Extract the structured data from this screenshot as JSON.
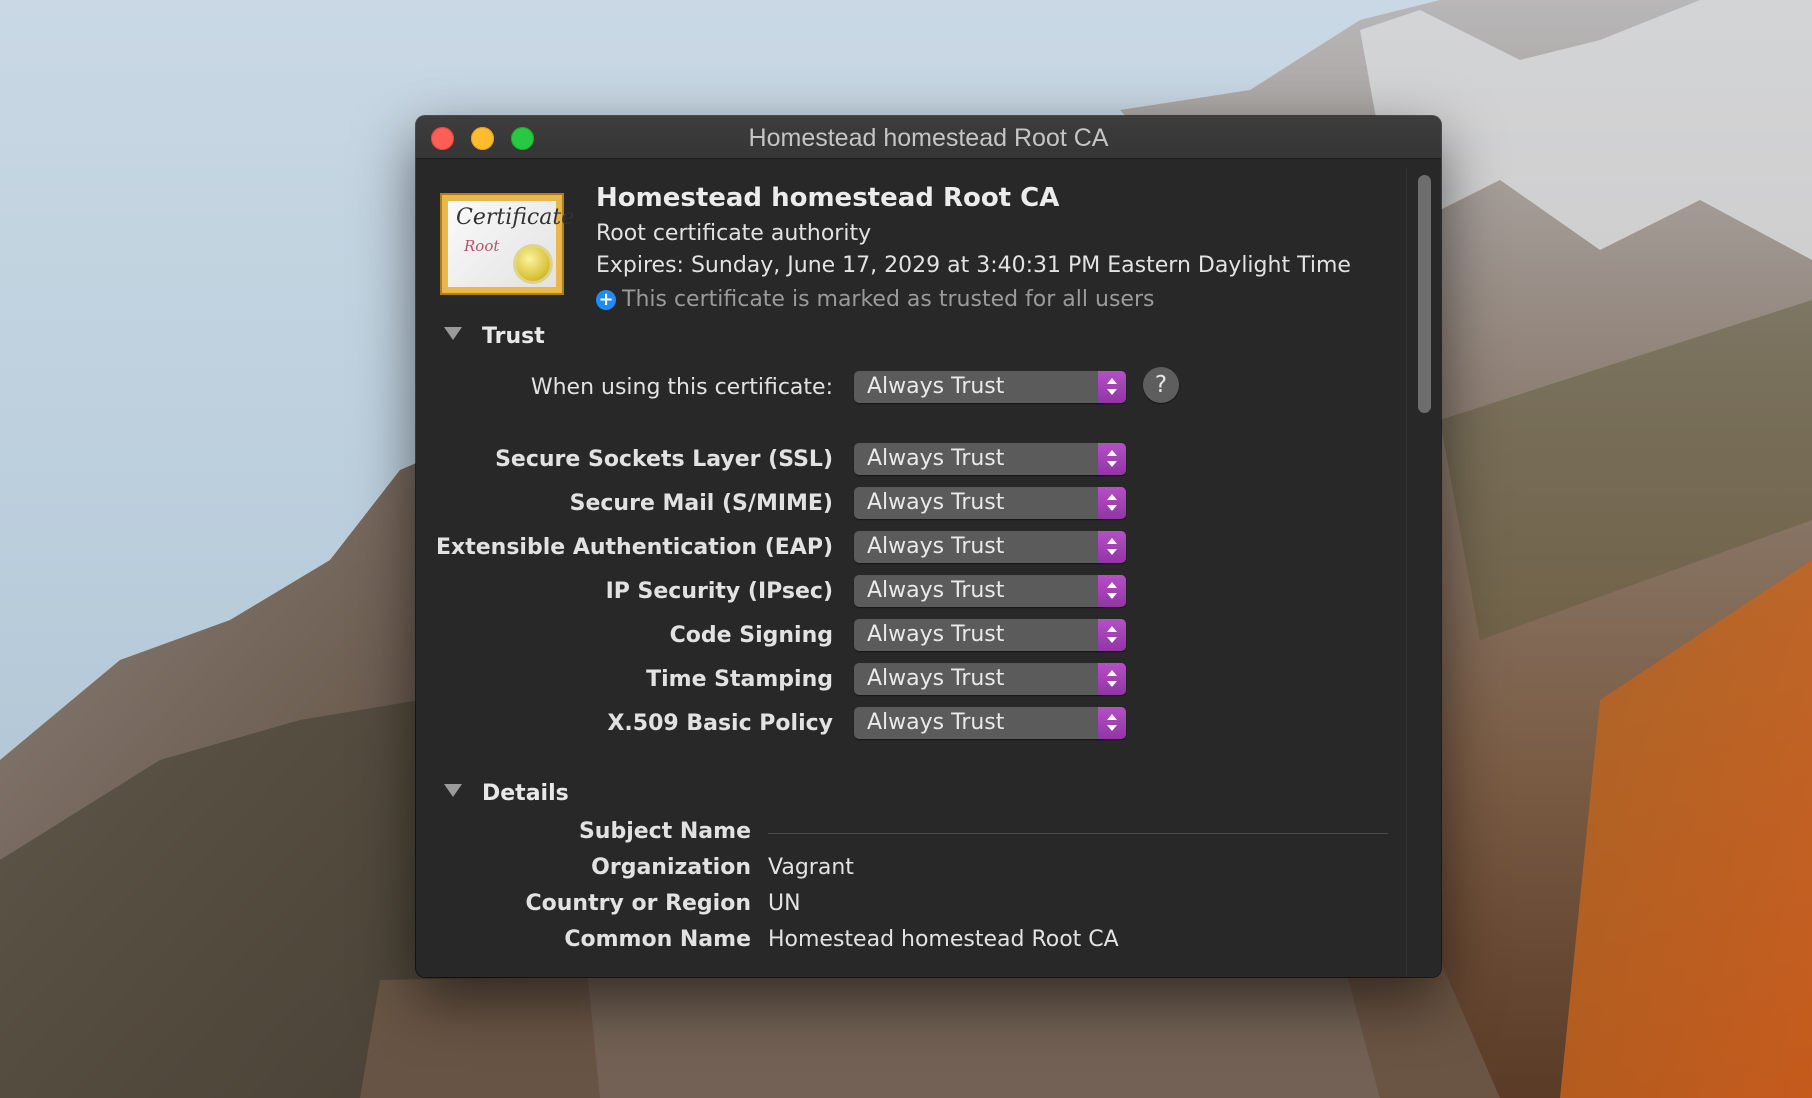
{
  "window": {
    "title": "Homestead homestead Root CA"
  },
  "certificate": {
    "icon_word": "Certificate",
    "icon_subword": "Root",
    "name": "Homestead homestead Root CA",
    "kind": "Root certificate authority",
    "expires": "Expires: Sunday, June 17, 2029 at 3:40:31 PM Eastern Daylight Time",
    "trust_status_icon": "plus-circle-icon",
    "trust_status": "This certificate is marked as trusted for all users"
  },
  "trust": {
    "heading": "Trust",
    "when_using_label": "When using this certificate:",
    "when_using_value": "Always Trust",
    "help_label": "?",
    "policies": [
      {
        "label": "Secure Sockets Layer (SSL)",
        "value": "Always Trust"
      },
      {
        "label": "Secure Mail (S/MIME)",
        "value": "Always Trust"
      },
      {
        "label": "Extensible Authentication (EAP)",
        "value": "Always Trust"
      },
      {
        "label": "IP Security (IPsec)",
        "value": "Always Trust"
      },
      {
        "label": "Code Signing",
        "value": "Always Trust"
      },
      {
        "label": "Time Stamping",
        "value": "Always Trust"
      },
      {
        "label": "X.509 Basic Policy",
        "value": "Always Trust"
      }
    ]
  },
  "details": {
    "heading": "Details",
    "subject_name_label": "Subject Name",
    "fields": [
      {
        "label": "Organization",
        "value": "Vagrant"
      },
      {
        "label": "Country or Region",
        "value": "UN"
      },
      {
        "label": "Common Name",
        "value": "Homestead homestead Root CA"
      }
    ]
  },
  "colors": {
    "popup_accent": "#a643b8",
    "window_bg": "#282828",
    "close": "#fd5f57",
    "minimize": "#febc2e",
    "zoom": "#28c840"
  }
}
